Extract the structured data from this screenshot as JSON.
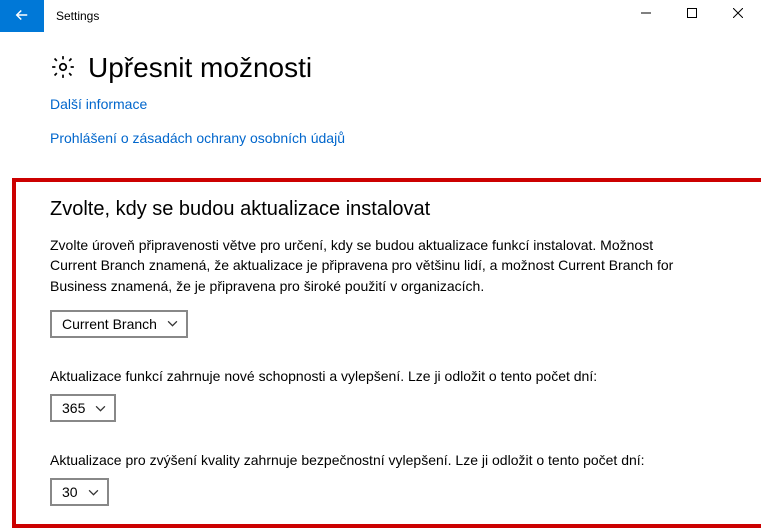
{
  "titlebar": {
    "title": "Settings"
  },
  "page": {
    "heading": "Upřesnit možnosti",
    "link_more_info": "Další informace",
    "link_privacy": "Prohlášení o zásadách ochrany osobních údajů"
  },
  "section": {
    "title": "Zvolte, kdy se budou aktualizace instalovat",
    "intro": "Zvolte úroveň připravenosti větve pro určení, kdy se budou aktualizace funkcí instalovat. Možnost Current Branch znamená, že aktualizace je připravena pro většinu lidí, a možnost Current Branch for Business znamená, že je připravena pro široké použití v organizacích.",
    "branch_select": "Current Branch",
    "feature_text": "Aktualizace funkcí zahrnuje nové schopnosti a vylepšení. Lze ji odložit o tento počet dní:",
    "feature_days": "365",
    "quality_text": "Aktualizace pro zvýšení kvality zahrnuje bezpečnostní vylepšení. Lze ji odložit o tento počet dní:",
    "quality_days": "30"
  }
}
